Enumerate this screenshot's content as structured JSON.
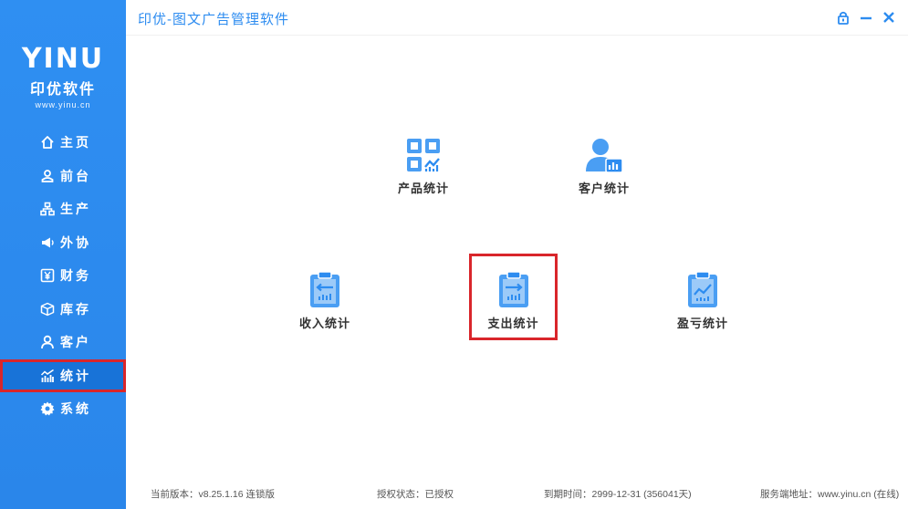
{
  "app": {
    "title": "印优-图文广告管理软件",
    "logo_mark": "YINU",
    "logo_name": "印优软件",
    "logo_url": "www.yinu.cn"
  },
  "sidebar": {
    "items": [
      {
        "label": "主页",
        "icon": "home-icon"
      },
      {
        "label": "前台",
        "icon": "user-outline-icon"
      },
      {
        "label": "生产",
        "icon": "org-chart-icon"
      },
      {
        "label": "外协",
        "icon": "megaphone-icon"
      },
      {
        "label": "财务",
        "icon": "yen-icon"
      },
      {
        "label": "库存",
        "icon": "box-icon"
      },
      {
        "label": "客户",
        "icon": "person-icon"
      },
      {
        "label": "统计",
        "icon": "stats-icon",
        "active": true
      },
      {
        "label": "系统",
        "icon": "gear-icon"
      }
    ]
  },
  "tiles": [
    {
      "label": "产品统计",
      "icon": "product-stats-icon"
    },
    {
      "label": "客户统计",
      "icon": "customer-stats-icon"
    },
    {
      "label": "收入统计",
      "icon": "income-stats-icon"
    },
    {
      "label": "支出统计",
      "icon": "expense-stats-icon",
      "selected": true
    },
    {
      "label": "盈亏统计",
      "icon": "profit-loss-stats-icon"
    }
  ],
  "footer": {
    "version": "当前版本：v8.25.1.16  连锁版",
    "license": "授权状态：已授权",
    "expiry": "到期时间：2999-12-31 (356041天)",
    "server": "服务端地址：www.yinu.cn (在线)"
  },
  "colors": {
    "brand": "#2d8cf0",
    "active_nav": "#1873d8",
    "highlight": "#d9262b"
  }
}
